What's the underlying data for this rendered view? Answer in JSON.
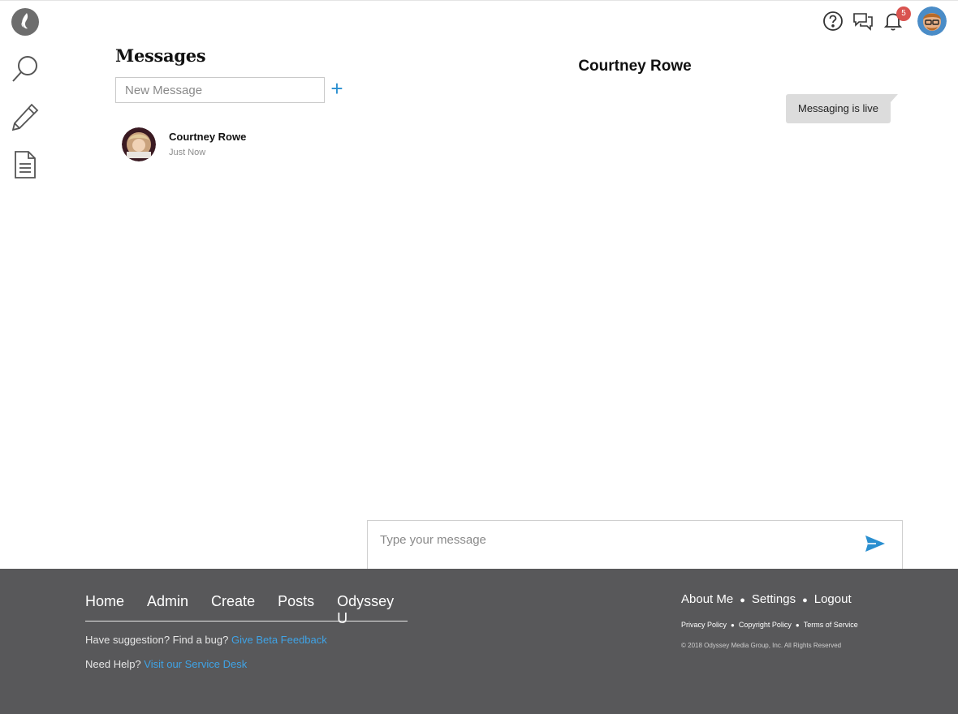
{
  "rail": {
    "icons": [
      "logo-icon",
      "search-icon",
      "pencil-icon",
      "document-icon"
    ]
  },
  "topbar": {
    "notification_count": "5"
  },
  "messages": {
    "title": "Messages",
    "new_message_placeholder": "New Message",
    "conversations": [
      {
        "name": "Courtney Rowe",
        "time": "Just Now"
      }
    ]
  },
  "conversation": {
    "title": "Courtney Rowe",
    "messages": [
      {
        "text": "Messaging is live",
        "from": "me"
      }
    ],
    "input_placeholder": "Type your message"
  },
  "footer": {
    "nav": [
      "Home",
      "Admin",
      "Create",
      "Posts",
      "Odyssey U"
    ],
    "feedback_text": "Have suggestion? Find a bug?",
    "feedback_link": "Give Beta Feedback",
    "help_text": "Need Help?",
    "help_link": "Visit our Service Desk",
    "account_links": [
      "About Me",
      "Settings",
      "Logout"
    ],
    "legal_links": [
      "Privacy Policy",
      "Copyright Policy",
      "Terms of Service"
    ],
    "copyright": "© 2018 Odyssey Media Group, Inc. All Rights Reserved"
  },
  "colors": {
    "accent": "#2a8fd0",
    "footer_bg": "#58585a",
    "link": "#3fa3e6",
    "badge": "#d9534f"
  }
}
